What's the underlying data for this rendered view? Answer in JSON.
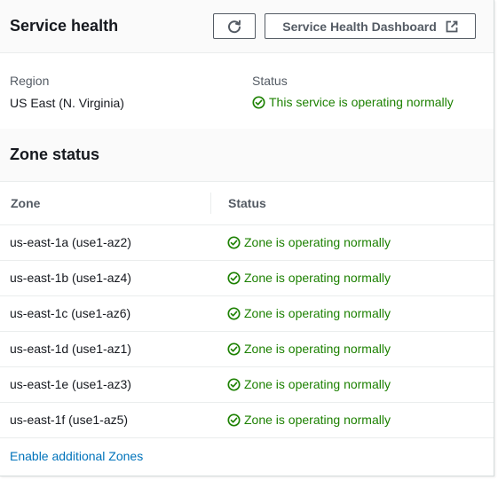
{
  "header": {
    "title": "Service health",
    "refresh_icon": "refresh-icon",
    "dashboard_button_label": "Service Health Dashboard",
    "external_icon": "external-link-icon"
  },
  "summary": {
    "region_label": "Region",
    "region_value": "US East (N. Virginia)",
    "status_label": "Status",
    "status_value": "This service is operating normally"
  },
  "zones": {
    "title": "Zone status",
    "columns": [
      "Zone",
      "Status"
    ],
    "rows": [
      {
        "zone": "us-east-1a (use1-az2)",
        "status": "Zone is operating normally"
      },
      {
        "zone": "us-east-1b (use1-az4)",
        "status": "Zone is operating normally"
      },
      {
        "zone": "us-east-1c (use1-az6)",
        "status": "Zone is operating normally"
      },
      {
        "zone": "us-east-1d (use1-az1)",
        "status": "Zone is operating normally"
      },
      {
        "zone": "us-east-1e (use1-az3)",
        "status": "Zone is operating normally"
      },
      {
        "zone": "us-east-1f (use1-az5)",
        "status": "Zone is operating normally"
      }
    ],
    "status_icon": "check-circle-icon"
  },
  "footer": {
    "link_label": "Enable additional Zones"
  },
  "colors": {
    "success": "#1d8102",
    "link": "#0073bb",
    "text": "#16191f",
    "muted": "#545b64"
  }
}
